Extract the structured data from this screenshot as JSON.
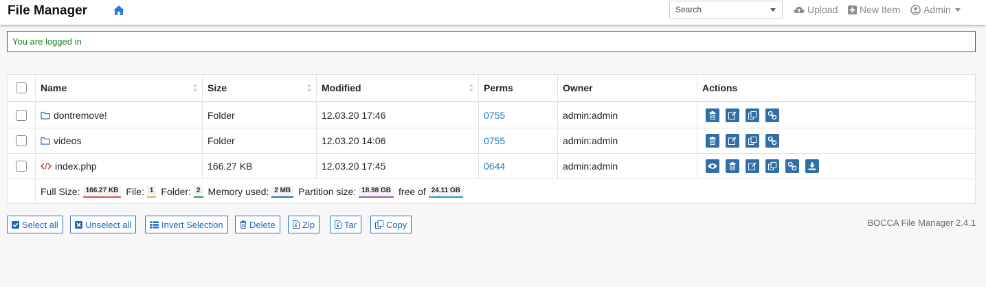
{
  "app": {
    "title": "File Manager",
    "version_text": "BOCCA File Manager 2.4.1"
  },
  "nav": {
    "search_placeholder": "Search",
    "upload_label": "Upload",
    "new_item_label": "New Item",
    "admin_label": "Admin"
  },
  "alert": {
    "message": "You are logged in"
  },
  "table": {
    "headers": {
      "name": "Name",
      "size": "Size",
      "modified": "Modified",
      "perms": "Perms",
      "owner": "Owner",
      "actions": "Actions"
    },
    "rows": [
      {
        "name": "dontremove!",
        "icon": "folder-icon",
        "size": "Folder",
        "modified": "12.03.20 17:46",
        "perms": "0755",
        "owner": "admin:admin",
        "actions": [
          "delete",
          "rename",
          "copy",
          "link"
        ]
      },
      {
        "name": "videos",
        "icon": "folder-icon",
        "size": "Folder",
        "modified": "12.03.20 14:06",
        "perms": "0755",
        "owner": "admin:admin",
        "actions": [
          "delete",
          "rename",
          "copy",
          "link"
        ]
      },
      {
        "name": "index.php",
        "icon": "code-file-icon",
        "size": "166.27 KB",
        "modified": "12.03.20 17:45",
        "perms": "0644",
        "owner": "admin:admin",
        "actions": [
          "view",
          "delete",
          "rename",
          "copy",
          "link",
          "download"
        ]
      }
    ],
    "footer": {
      "full_size_label": "Full Size:",
      "full_size_value": "166.27 KB",
      "file_label": "File:",
      "file_count": "1",
      "folder_label": "Folder:",
      "folder_count": "2",
      "memory_label": "Memory used:",
      "memory_value": "2 MB",
      "partition_label": "Partition size:",
      "partition_value": "18.98 GB",
      "free_label": "free of",
      "free_value": "24.11 GB"
    }
  },
  "buttons": {
    "select_all": "Select all",
    "unselect_all": "Unselect all",
    "invert_selection": "Invert Selection",
    "delete": "Delete",
    "zip": "Zip",
    "tar": "Tar",
    "copy": "Copy"
  },
  "colors": {
    "accent": "#2f6fa6",
    "link": "#1a7fc4",
    "success": "#1a7f1a",
    "badge_full_size": "#d9534f",
    "badge_file": "#f0ad4e",
    "badge_folder": "#28a745",
    "badge_memory": "#2a6ebf",
    "badge_partition": "#9b59b6",
    "badge_free": "#17a2b8"
  }
}
